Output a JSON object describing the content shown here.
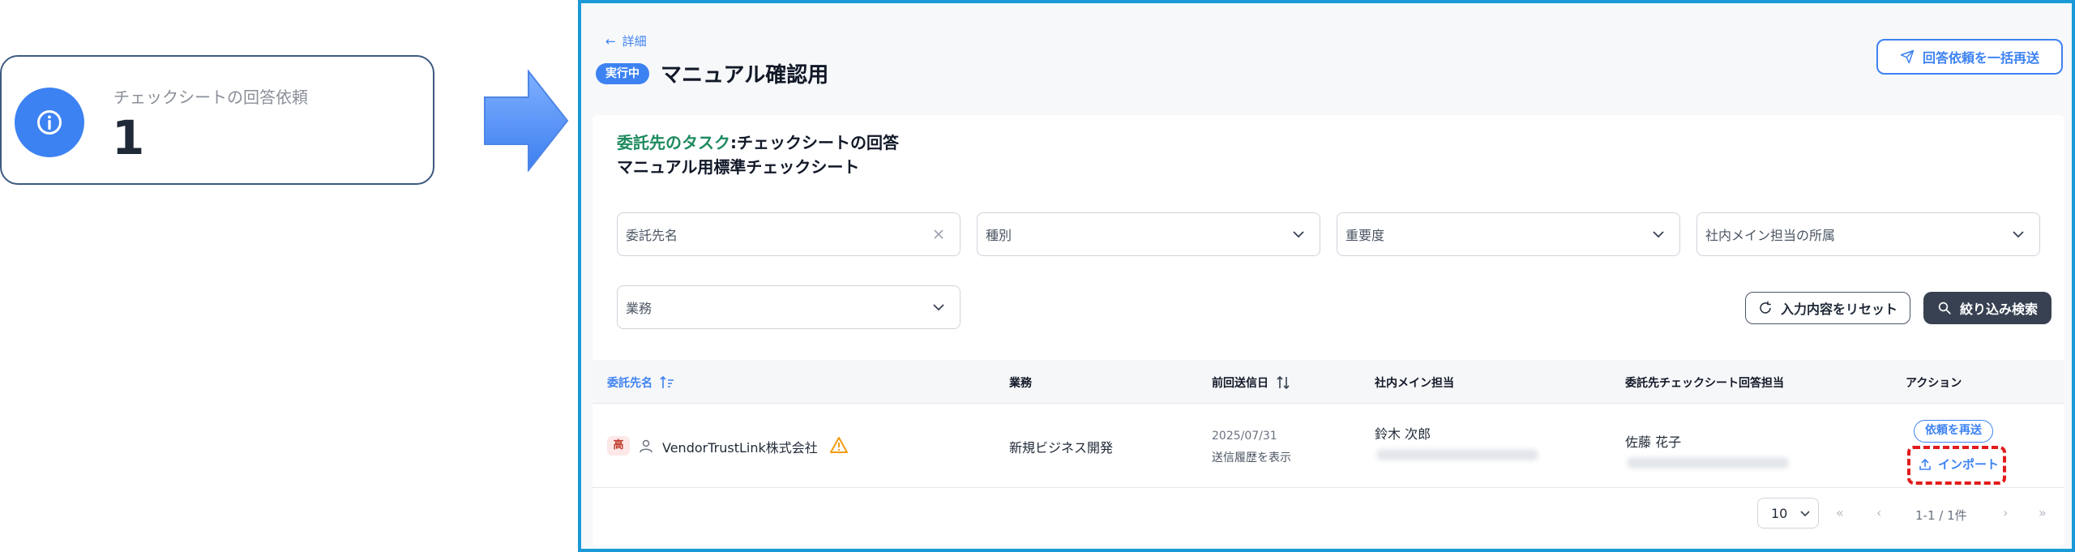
{
  "stat_card": {
    "label": "チェックシートの回答依頼",
    "value": "1"
  },
  "header": {
    "back_label": "詳細",
    "status": "実行中",
    "title": "マニュアル確認用",
    "resend_all_label": "回答依頼を一括再送"
  },
  "task": {
    "prefix": "委託先のタスク",
    "separator": ":",
    "name": "チェックシートの回答",
    "sheet_name": "マニュアル用標準チェックシート"
  },
  "filters": {
    "vendor_name": "委託先名",
    "type": "種別",
    "importance": "重要度",
    "department": "社内メイン担当の所属",
    "business": "業務"
  },
  "buttons": {
    "reset": "入力内容をリセット",
    "search": "絞り込み検索"
  },
  "table": {
    "headers": {
      "vendor": "委託先名",
      "business": "業務",
      "last_sent": "前回送信日",
      "main_contact": "社内メイン担当",
      "sheet_contact": "委託先チェックシート回答担当",
      "action": "アクション"
    },
    "rows": [
      {
        "priority": "高",
        "vendor": "VendorTrustLink株式会社",
        "business": "新規ビジネス開発",
        "last_sent": "2025/07/31",
        "history_link": "送信履歴を表示",
        "main_contact": "鈴木 次郎",
        "sheet_contact": "佐藤 花子",
        "resend_label": "依頼を再送",
        "import_label": "インポート"
      }
    ]
  },
  "pagination": {
    "page_size": "10",
    "count": "1-1 / 1件"
  },
  "colors": {
    "accent": "#3d82f2",
    "task_green": "#1e8a5e",
    "highlight": "#e21b1b",
    "panel_border": "#1a9ad6"
  }
}
